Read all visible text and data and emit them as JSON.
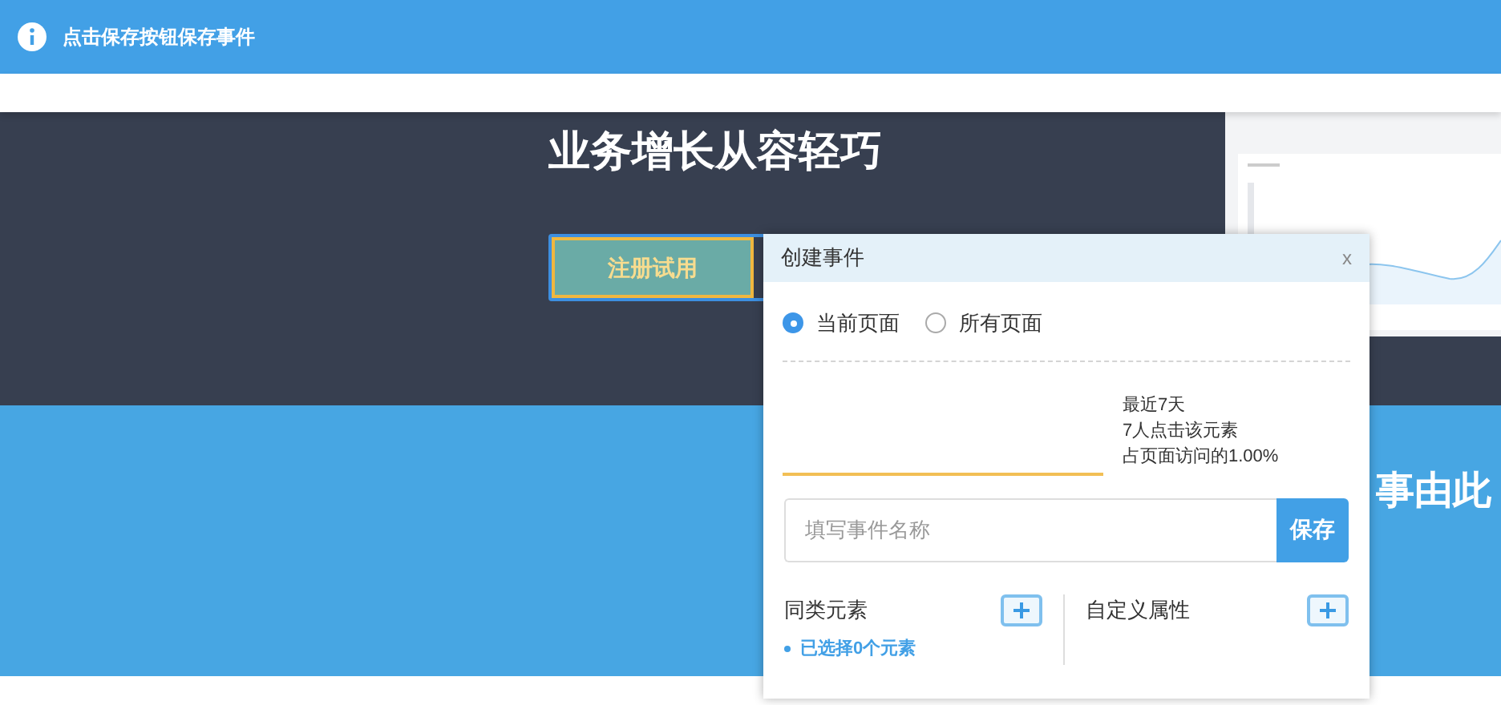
{
  "notice": {
    "text": "点击保存按钮保存事件"
  },
  "hero": {
    "headline": "业务增长从容轻巧",
    "cta": "注册试用"
  },
  "band": {
    "text": "事由此"
  },
  "dialog": {
    "title": "创建事件",
    "close": "x",
    "scope": [
      {
        "label": "当前页面",
        "selected": true
      },
      {
        "label": "所有页面",
        "selected": false
      }
    ],
    "stats": [
      "最近7天",
      "7人点击该元素",
      "占页面访问的1.00%"
    ],
    "name_field": {
      "placeholder": "填写事件名称"
    },
    "save": "保存",
    "sections": [
      {
        "label": "同类元素",
        "note": "已选择0个元素"
      },
      {
        "label": "自定义属性"
      }
    ]
  }
}
